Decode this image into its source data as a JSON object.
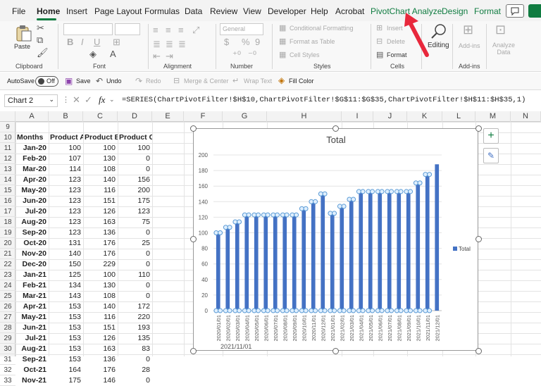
{
  "tabs": [
    "File",
    "Home",
    "Insert",
    "Page Layout",
    "Formulas",
    "Data",
    "Review",
    "View",
    "Developer",
    "Help",
    "Acrobat",
    "PivotChart Analyze",
    "Design",
    "Format"
  ],
  "ribbon": {
    "paste": "Paste",
    "groups": {
      "clipboard": "Clipboard",
      "font": "Font",
      "alignment": "Alignment",
      "number": "Number",
      "styles": "Styles",
      "cells": "Cells",
      "addins": "Add-ins"
    },
    "number_format": "General",
    "conditional_formatting": "Conditional Formatting",
    "format_as_table": "Format as Table",
    "cell_styles": "Cell Styles",
    "insert": "Insert",
    "delete": "Delete",
    "format": "Format",
    "editing": "Editing",
    "addins_btn": "Add-ins",
    "analyze_data": "Analyze Data"
  },
  "quick": {
    "autosave": "AutoSave",
    "autosave_state": "Off",
    "save": "Save",
    "undo": "Undo",
    "redo": "Redo",
    "merge": "Merge & Center",
    "wrap": "Wrap Text",
    "fill": "Fill Color"
  },
  "formula_bar": {
    "name_box": "Chart 2",
    "fx": "fx",
    "formula": "=SERIES(ChartPivotFilter!$H$10,ChartPivotFilter!$G$11:$G$35,ChartPivotFilter!$H$11:$H$35,1)"
  },
  "columns": [
    "A",
    "B",
    "C",
    "D",
    "E",
    "F",
    "G",
    "H",
    "I",
    "J",
    "K",
    "L",
    "M",
    "N"
  ],
  "rows": [
    "9",
    "10",
    "11",
    "12",
    "13",
    "14",
    "15",
    "16",
    "17",
    "18",
    "19",
    "20",
    "21",
    "22",
    "23",
    "24",
    "25",
    "26",
    "27",
    "28",
    "29",
    "30",
    "31",
    "32",
    "33"
  ],
  "table": {
    "headers": [
      "Months",
      "Product A",
      "Product B",
      "Product C"
    ],
    "data": [
      [
        "Jan-20",
        "100",
        "100",
        "100"
      ],
      [
        "Feb-20",
        "107",
        "130",
        "0"
      ],
      [
        "Mar-20",
        "114",
        "108",
        "0"
      ],
      [
        "Apr-20",
        "123",
        "140",
        "156"
      ],
      [
        "May-20",
        "123",
        "116",
        "200"
      ],
      [
        "Jun-20",
        "123",
        "151",
        "175"
      ],
      [
        "Jul-20",
        "123",
        "126",
        "123"
      ],
      [
        "Aug-20",
        "123",
        "163",
        "75"
      ],
      [
        "Sep-20",
        "123",
        "136",
        "0"
      ],
      [
        "Oct-20",
        "131",
        "176",
        "25"
      ],
      [
        "Nov-20",
        "140",
        "176",
        "0"
      ],
      [
        "Dec-20",
        "150",
        "229",
        "0"
      ],
      [
        "Jan-21",
        "125",
        "100",
        "110"
      ],
      [
        "Feb-21",
        "134",
        "130",
        "0"
      ],
      [
        "Mar-21",
        "143",
        "108",
        "0"
      ],
      [
        "Apr-21",
        "153",
        "140",
        "172"
      ],
      [
        "May-21",
        "153",
        "116",
        "220"
      ],
      [
        "Jun-21",
        "153",
        "151",
        "193"
      ],
      [
        "Jul-21",
        "153",
        "126",
        "135"
      ],
      [
        "Aug-21",
        "153",
        "163",
        "83"
      ],
      [
        "Sep-21",
        "153",
        "136",
        "0"
      ],
      [
        "Oct-21",
        "164",
        "176",
        "28"
      ],
      [
        "Nov-21",
        "175",
        "146",
        "0"
      ]
    ]
  },
  "chart_data": {
    "type": "bar",
    "title": "Total",
    "categories": [
      "2020/01/01",
      "2020/02/01",
      "2020/03/01",
      "2020/04/01",
      "2020/05/01",
      "2020/06/01",
      "2020/07/01",
      "2020/08/01",
      "2020/09/01",
      "2020/10/01",
      "2020/11/01",
      "2020/12/01",
      "2021/01/01",
      "2021/02/01",
      "2021/03/01",
      "2021/04/01",
      "2021/05/01",
      "2021/06/01",
      "2021/07/01",
      "2021/08/01",
      "2021/09/01",
      "2021/10/01",
      "2021/11/01",
      "2021/12/01"
    ],
    "series": [
      {
        "name": "Total",
        "values": [
          100,
          107,
          114,
          123,
          123,
          123,
          123,
          123,
          123,
          131,
          140,
          150,
          125,
          134,
          143,
          153,
          153,
          153,
          153,
          153,
          153,
          164,
          175,
          188
        ]
      }
    ],
    "ylim": [
      0,
      200
    ],
    "yticks": [
      0,
      20,
      40,
      60,
      80,
      100,
      120,
      140,
      160,
      180,
      200
    ],
    "legend": "right",
    "bar_color": "#4472c4",
    "marker_color": "#5b9bd5"
  },
  "overlay_text": "2021/11/01",
  "colors": {
    "accent": "#107c41",
    "arrow": "#e8283c"
  }
}
